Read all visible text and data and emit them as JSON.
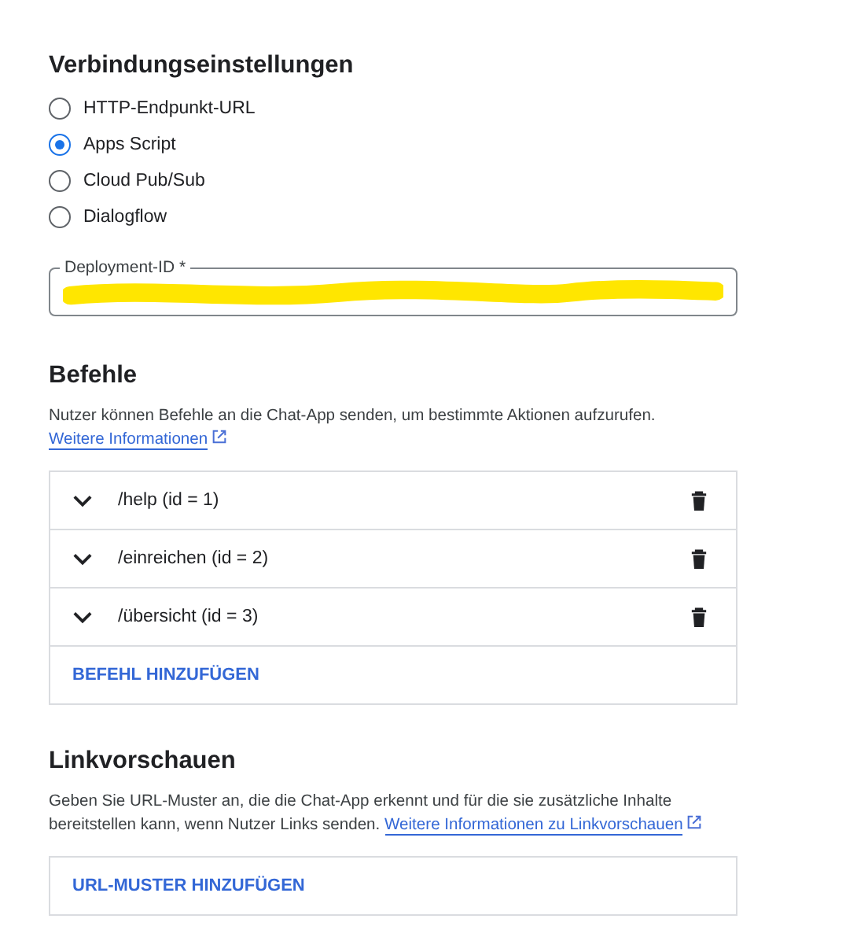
{
  "connection": {
    "title": "Verbindungseinstellungen",
    "options": [
      {
        "label": "HTTP-Endpunkt-URL",
        "selected": false
      },
      {
        "label": "Apps Script",
        "selected": true
      },
      {
        "label": "Cloud Pub/Sub",
        "selected": false
      },
      {
        "label": "Dialogflow",
        "selected": false
      }
    ],
    "deployment_field": {
      "label": "Deployment-ID *"
    }
  },
  "commands": {
    "title": "Befehle",
    "description": "Nutzer können Befehle an die Chat-App senden, um bestimmte Aktionen aufzurufen.",
    "link": "Weitere Informationen",
    "items": [
      {
        "label": "/help (id = 1)"
      },
      {
        "label": "/einreichen (id = 2)"
      },
      {
        "label": "/übersicht (id = 3)"
      }
    ],
    "add_button": "BEFEHL HINZUFÜGEN"
  },
  "link_previews": {
    "title": "Linkvorschauen",
    "description": "Geben Sie URL-Muster an, die die Chat-App erkennt und für die sie zusätzliche Inhalte bereitstellen kann, wenn Nutzer Links senden.",
    "link": "Weitere Informationen zu Linkvorschauen",
    "add_button": "URL-MUSTER HINZUFÜGEN"
  }
}
